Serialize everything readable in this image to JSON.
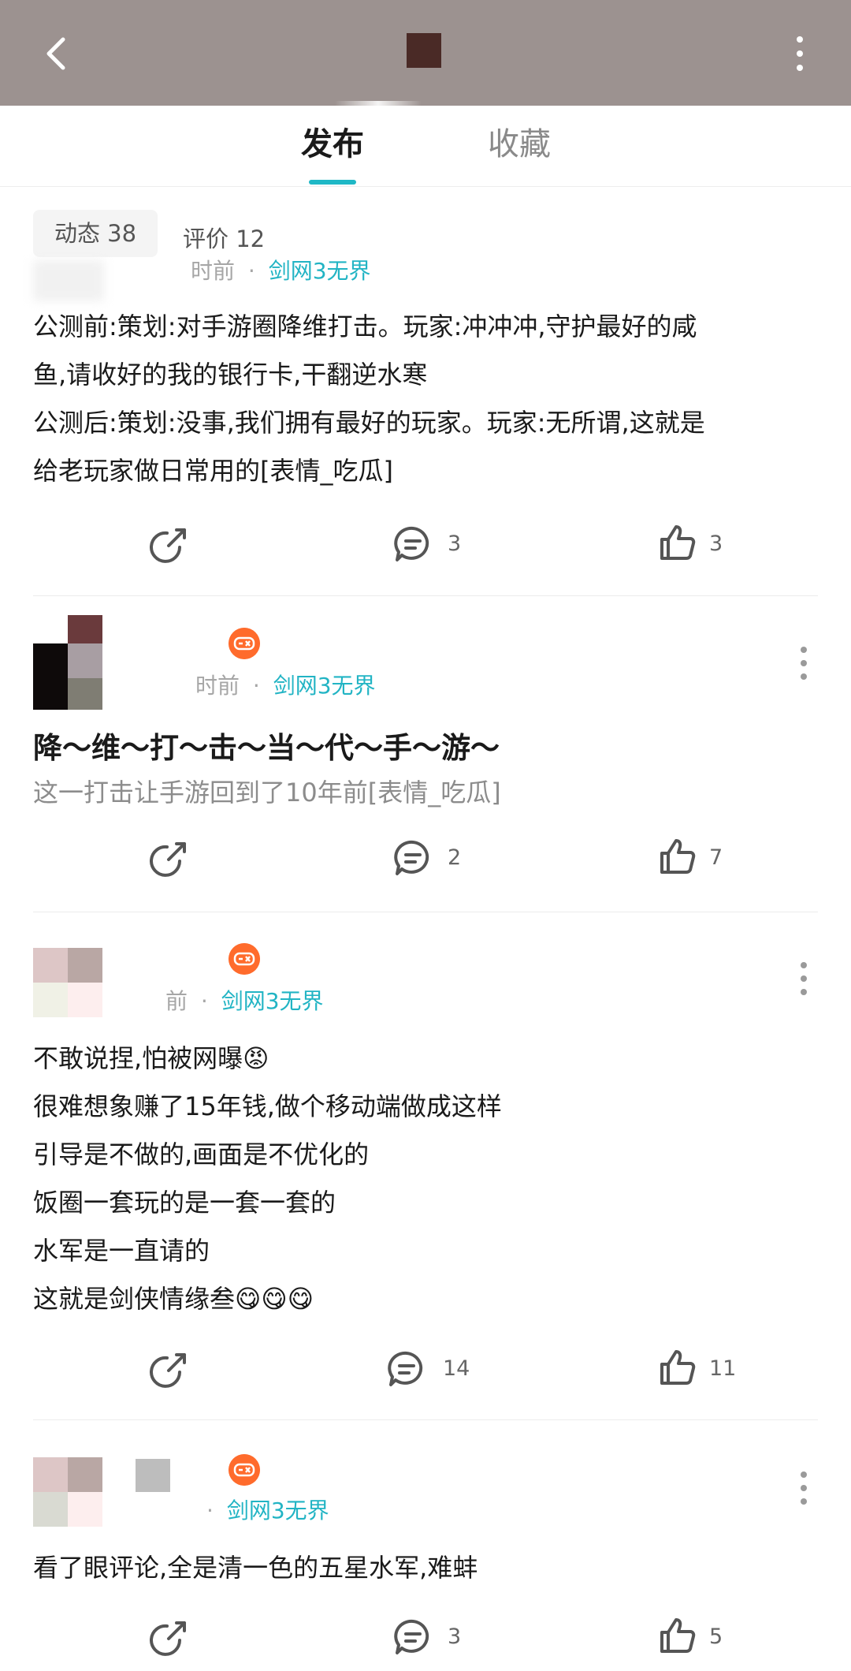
{
  "header": {
    "back_icon": "chevron-left-icon",
    "more_icon": "more-vertical-icon"
  },
  "tabs": [
    {
      "label": "发布",
      "active": true
    },
    {
      "label": "收藏",
      "active": false
    }
  ],
  "stats": {
    "dynamic": "动态 38",
    "reviews": "评价 12"
  },
  "colors": {
    "accent": "#1fb8c6",
    "game_tag": "#22b4c4",
    "badge": "#ff6b2c",
    "topbar": "#9c9290"
  },
  "posts": [
    {
      "time": "时前",
      "dot": "·",
      "game": "剑网3无界",
      "lines": [
        "公测前:策划:对手游圈降维打击。玩家:冲冲冲,守护最好的咸",
        "鱼,请收好的我的银行卡,干翻逆水寒",
        "公测后:策划:没事,我们拥有最好的玩家。玩家:无所谓,这就是",
        "给老玩家做日常用的[表情_吃瓜]"
      ],
      "comments": "3",
      "likes": "3"
    },
    {
      "time": "时前",
      "dot": "·",
      "game": "剑网3无界",
      "title": "降～维～打～击～当～代～手～游～",
      "sub": "这一打击让手游回到了10年前[表情_吃瓜]",
      "comments": "2",
      "likes": "7"
    },
    {
      "time": "前",
      "dot": "·",
      "game": "剑网3无界",
      "lines": [
        "不敢说捏,怕被网曝😡",
        "很难想象赚了15年钱,做个移动端做成这样",
        "引导是不做的,画面是不优化的",
        "饭圈一套玩的是一套一套的",
        "水军是一直请的",
        "这就是剑侠情缘叁😋😋😋"
      ],
      "comments": "14",
      "likes": "11"
    },
    {
      "dot": "·",
      "game": "剑网3无界",
      "lines": [
        "看了眼评论,全是清一色的五星水军,难蚌"
      ],
      "comments": "3",
      "likes": "5"
    }
  ]
}
